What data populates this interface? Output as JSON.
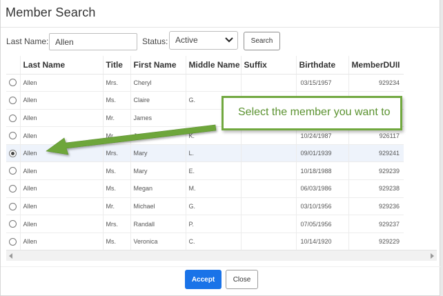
{
  "dialog": {
    "title": "Member Search"
  },
  "filters": {
    "last_name_label": "Last Name:",
    "last_name_value": "Allen",
    "status_label": "Status:",
    "status_value": "Active",
    "search_label": "Search"
  },
  "grid": {
    "columns": [
      "Last Name",
      "Title",
      "First Name",
      "Middle Name",
      "Suffix",
      "Birthdate",
      "MemberDUII"
    ],
    "rows": [
      {
        "last": "Allen",
        "title": "Mrs.",
        "first": "Cheryl",
        "middle": "",
        "suffix": "",
        "birthdate": "03/15/1957",
        "member_id": "929234",
        "selected": false
      },
      {
        "last": "Allen",
        "title": "Ms.",
        "first": "Claire",
        "middle": "G.",
        "suffix": "",
        "birthdate": "",
        "member_id": "",
        "selected": false
      },
      {
        "last": "Allen",
        "title": "Mr.",
        "first": "James",
        "middle": "",
        "suffix": "",
        "birthdate": "",
        "member_id": "",
        "selected": false
      },
      {
        "last": "Allen",
        "title": "Mr.",
        "first": "Justin",
        "middle": "K.",
        "suffix": "",
        "birthdate": "10/24/1987",
        "member_id": "926117",
        "selected": false
      },
      {
        "last": "Allen",
        "title": "Mrs.",
        "first": "Mary",
        "middle": "L.",
        "suffix": "",
        "birthdate": "09/01/1939",
        "member_id": "929241",
        "selected": true
      },
      {
        "last": "Allen",
        "title": "Ms.",
        "first": "Mary",
        "middle": "E.",
        "suffix": "",
        "birthdate": "10/18/1988",
        "member_id": "929239",
        "selected": false
      },
      {
        "last": "Allen",
        "title": "Ms.",
        "first": "Megan",
        "middle": "M.",
        "suffix": "",
        "birthdate": "06/03/1986",
        "member_id": "929238",
        "selected": false
      },
      {
        "last": "Allen",
        "title": "Mr.",
        "first": "Michael",
        "middle": "G.",
        "suffix": "",
        "birthdate": "03/10/1956",
        "member_id": "929236",
        "selected": false
      },
      {
        "last": "Allen",
        "title": "Mrs.",
        "first": "Randall",
        "middle": "P.",
        "suffix": "",
        "birthdate": "07/05/1956",
        "member_id": "929237",
        "selected": false
      },
      {
        "last": "Allen",
        "title": "Ms.",
        "first": "Veronica",
        "middle": "C.",
        "suffix": "",
        "birthdate": "10/14/1920",
        "member_id": "929229",
        "selected": false
      }
    ]
  },
  "footer": {
    "accept_label": "Accept",
    "close_label": "Close"
  },
  "callout": {
    "text": "Select the member you want to"
  },
  "icons": {
    "status_dropdown": "chevron-down-icon",
    "scroll_left": "scroll-left-icon",
    "scroll_right": "scroll-right-icon",
    "callout_arrow": "arrow-icon"
  },
  "colors": {
    "accent": "#1a73e8",
    "callout_green": "#71a83f",
    "callout_text": "#5b9230",
    "arrow_green": "#6ea63a",
    "selected_row": "#eef3fb"
  }
}
